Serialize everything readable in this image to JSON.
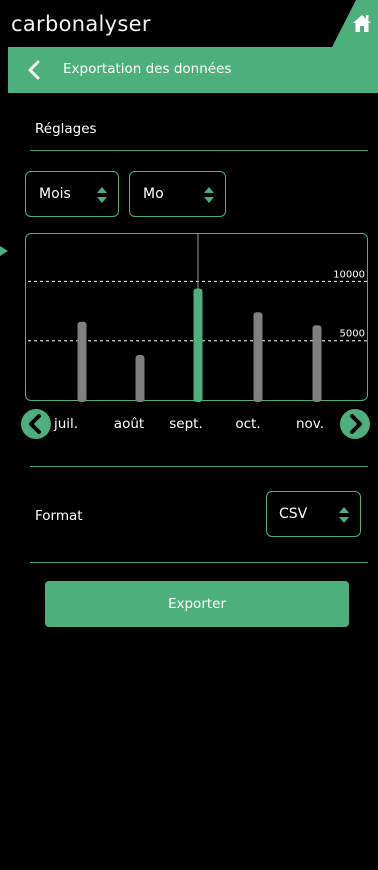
{
  "app": {
    "brand": "carbonalyser"
  },
  "header": {
    "home_icon": "home-icon"
  },
  "navbar": {
    "title": "Exportation des données",
    "back_icon": "chevron-left-icon"
  },
  "settings": {
    "title": "Réglages"
  },
  "selects": {
    "period": {
      "value": "Mois"
    },
    "unit": {
      "value": "Mo"
    }
  },
  "chart_nav": {
    "prev_icon": "chevron-left-icon",
    "next_icon": "chevron-right-icon"
  },
  "format": {
    "label": "Format",
    "value": "CSV"
  },
  "export": {
    "label": "Exporter"
  },
  "colors": {
    "accent": "#4caf7c",
    "bar": "#808080",
    "background": "#000000"
  },
  "chart_data": {
    "type": "bar",
    "categories": [
      "juil.",
      "août",
      "sept.",
      "oct.",
      "nov."
    ],
    "values": [
      6600,
      3800,
      9400,
      7400,
      6300
    ],
    "selected": "sept.",
    "gridlines": [
      10000,
      5000
    ],
    "gridline_labels": [
      "10000",
      "5000"
    ],
    "ylim": [
      0,
      14000
    ]
  }
}
